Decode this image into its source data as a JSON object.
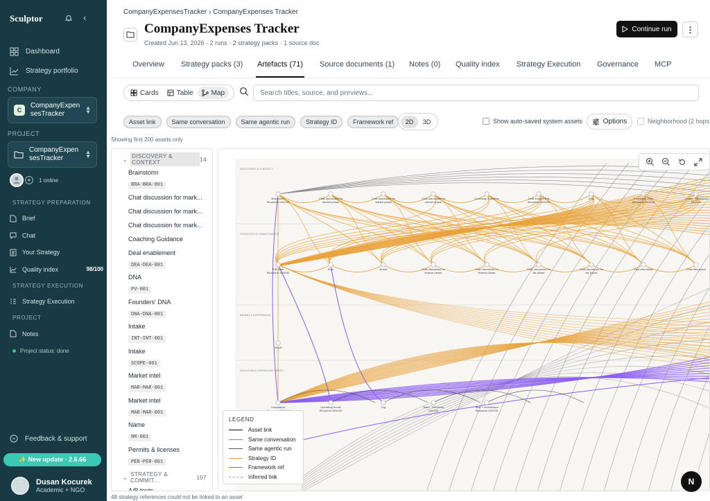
{
  "sidebar": {
    "brand": "Sculptor",
    "nav": [
      {
        "label": "Dashboard",
        "icon": "grid-icon"
      },
      {
        "label": "Strategy portfolio",
        "icon": "chart-line-icon"
      }
    ],
    "company_heading": "COMPANY",
    "company": {
      "initial": "C",
      "name": "CompanyExpensesTracker"
    },
    "project_heading": "PROJECT",
    "project": {
      "name": "CompanyExpensesTracker"
    },
    "online_text": "1 online",
    "prep_heading": "STRATEGY PREPARATION",
    "prep_items": [
      {
        "label": "Brief"
      },
      {
        "label": "Chat"
      },
      {
        "label": "Your Strategy"
      },
      {
        "label": "Quality index",
        "score": "98/100"
      }
    ],
    "exec_heading": "STRATEGY EXECUTION",
    "exec_items": [
      {
        "label": "Strategy Execution"
      }
    ],
    "proj_heading": "PROJECT",
    "proj_items": [
      {
        "label": "Notes"
      }
    ],
    "project_status": "Project status: done",
    "feedback": "Feedback & support",
    "update": "✨ New update · 2.6.66",
    "user": {
      "name": "Dusan Kocurek",
      "role": "Academic + NGO"
    }
  },
  "header": {
    "breadcrumb": "CompanyExpensesTracker › CompanyExpenses Tracker",
    "title": "CompanyExpenses Tracker",
    "meta": "Created Jun 13, 2026 · 2 runs · 2 strategy packs · 1 source doc",
    "continue": "Continue run",
    "more": "⋮"
  },
  "tabs": [
    {
      "label": "Overview"
    },
    {
      "label": "Strategy packs (3)"
    },
    {
      "label": "Artefacts (71)",
      "active": true
    },
    {
      "label": "Source documents (1)"
    },
    {
      "label": "Notes (0)"
    },
    {
      "label": "Quality index"
    },
    {
      "label": "Strategy Execution"
    },
    {
      "label": "Governance"
    },
    {
      "label": "MCP"
    }
  ],
  "view": {
    "cards": "Cards",
    "table": "Table",
    "map": "Map",
    "search_placeholder": "Search titles, source, and previews..."
  },
  "filters": [
    "Asset link",
    "Same conversation",
    "Same agentic run",
    "Strategy ID",
    "Framework ref"
  ],
  "dims": [
    "2D",
    "3D"
  ],
  "show_auto": "Show auto-saved system assets",
  "options": "Options",
  "neighborhood": "Neighborhood (2 hops",
  "showing": "Showing first 200 assets only",
  "list": {
    "group1": {
      "label": "DISCOVERY & CONTEXT",
      "count": "14"
    },
    "items1": [
      {
        "name": "Brainstorm",
        "id": "BRA-BRA-001"
      },
      {
        "name": "Chat discussion for mark...",
        "id": ""
      },
      {
        "name": "Chat discussion for mark...",
        "id": ""
      },
      {
        "name": "Chat discussion for mark...",
        "id": ""
      },
      {
        "name": "Coaching Guidance",
        "id": ""
      },
      {
        "name": "Deal enablement",
        "id": "DEA-DEA-001"
      },
      {
        "name": "DNA",
        "id": "PV-001"
      },
      {
        "name": "Founders' DNA",
        "id": "DNA-DNA-001"
      },
      {
        "name": "Intake",
        "id": "INT-INT-001"
      },
      {
        "name": "Intake",
        "id": "SCOPE-001"
      },
      {
        "name": "Market intel",
        "id": "MAR-MAR-001"
      },
      {
        "name": "Market intel",
        "id": "MAR-MAR-001"
      },
      {
        "name": "Name",
        "id": "NM-001"
      },
      {
        "name": "Permits & licenses",
        "id": "PER-PER-001"
      }
    ],
    "group2": {
      "label": "STRATEGY & COMMIT...",
      "count": "107"
    },
    "items2": [
      {
        "name": "A/B tests",
        "id": "ABT-ABT-001"
      }
    ]
  },
  "map": {
    "lane_labels": [
      "DISCOVERY & CONTEXT",
      "STRATEGY & COMMITMENTS",
      "BRAND & EXPERIENCE",
      "SOLUTION & OPERATING MODEL"
    ],
    "nodes": [
      {
        "label": "Brainstorm\nStructural 100/100",
        "lane": 0,
        "col": 0
      },
      {
        "label": "Chat discussion for\nmarket phase",
        "lane": 0,
        "col": 1
      },
      {
        "label": "Chat discussion for\nmarket phase",
        "lane": 0,
        "col": 2
      },
      {
        "label": "Chat discussion for\nmarket phase",
        "lane": 0,
        "col": 3
      },
      {
        "label": "Coaching Guidance",
        "lane": 0,
        "col": 4
      },
      {
        "label": "Deal enablement\nStructural 100/100",
        "lane": 0,
        "col": 5
      },
      {
        "label": "DNA",
        "lane": 0,
        "col": 6
      },
      {
        "label": "Founders' DNA\nStructural 100/100",
        "lane": 0,
        "col": 7
      },
      {
        "label": "Intake · Structural\n100/100",
        "lane": 0,
        "col": 8
      },
      {
        "label": "A/B tests\nStructural 100/100",
        "lane": 1,
        "col": 0
      },
      {
        "label": "Bold",
        "lane": 1,
        "col": 1
      },
      {
        "label": "Brand",
        "lane": 1,
        "col": 2
      },
      {
        "label": "Chat discussion for\nfinance phase",
        "lane": 1,
        "col": 3
      },
      {
        "label": "Chat discussion for\nfinance phase",
        "lane": 1,
        "col": 4
      },
      {
        "label": "Chat discussion for\nstir phase",
        "lane": 1,
        "col": 5
      },
      {
        "label": "Chat discussion for\nstir phase",
        "lane": 1,
        "col": 6
      },
      {
        "label": "Chat discussion",
        "lane": 1,
        "col": 7
      },
      {
        "label": "Chat discussion",
        "lane": 1,
        "col": 8
      },
      {
        "label": "Visual",
        "lane": 2,
        "col": 0
      },
      {
        "label": "Compliance\nStructural 100/100",
        "lane": 3,
        "col": 0
      },
      {
        "label": "Operating model\nStructural 100/100",
        "lane": 3,
        "col": 1
      },
      {
        "label": "Org",
        "lane": 3,
        "col": 2
      },
      {
        "label": "Team · Structural\n100/100",
        "lane": 3,
        "col": 3
      },
      {
        "label": "Tech + architecture\nStructural 100/100",
        "lane": 3,
        "col": 4
      }
    ]
  },
  "legend": {
    "title": "LEGEND",
    "rows": [
      {
        "label": "Asset link",
        "color": "#111111",
        "dash": false
      },
      {
        "label": "Same conversation",
        "color": "#8a8a8a",
        "dash": false
      },
      {
        "label": "Same agentic run",
        "color": "#555555",
        "dash": false
      },
      {
        "label": "Strategy ID",
        "color": "#e8a23a",
        "dash": false
      },
      {
        "label": "Framework ref",
        "color": "#8a5cf0",
        "dash": false
      },
      {
        "label": "Inferred link",
        "color": "#9a9a9a",
        "dash": true
      }
    ]
  },
  "badge": "N",
  "footer": "48 strategy references could not be linked to an asset"
}
